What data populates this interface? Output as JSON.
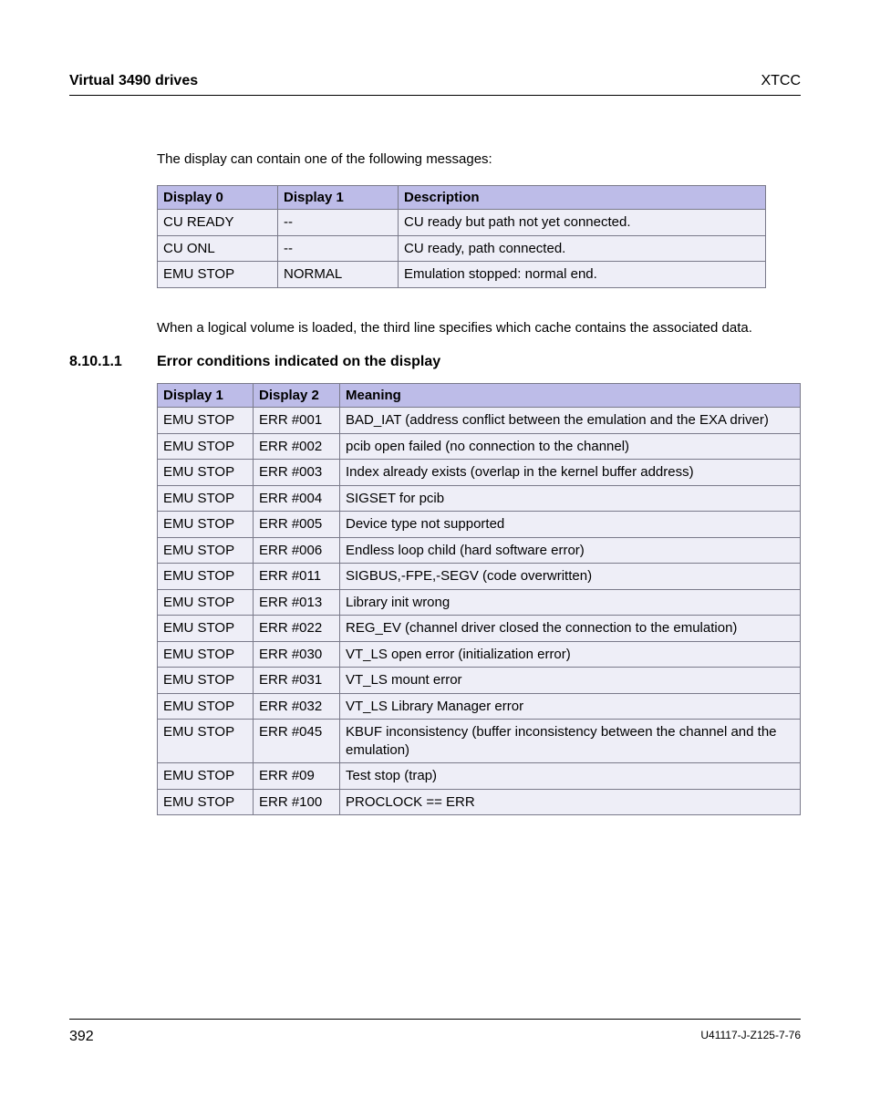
{
  "header": {
    "left": "Virtual 3490 drives",
    "right": "XTCC"
  },
  "intro_para": "The display can contain one of the following messages:",
  "table1": {
    "headers": [
      "Display 0",
      "Display 1",
      "Description"
    ],
    "rows": [
      [
        "CU READY",
        "--",
        "CU ready but path not yet connected."
      ],
      [
        "CU ONL",
        "--",
        "CU ready, path connected."
      ],
      [
        "EMU STOP",
        "NORMAL",
        "Emulation stopped: normal end."
      ]
    ]
  },
  "middle_para": "When a logical volume is loaded, the third line specifies which cache contains the associated data.",
  "section": {
    "number": "8.10.1.1",
    "title": "Error conditions indicated on the display"
  },
  "table2": {
    "headers": [
      "Display 1",
      "Display 2",
      "Meaning"
    ],
    "rows": [
      [
        "EMU STOP",
        "ERR #001",
        "BAD_IAT (address conflict between the emulation and the EXA driver)"
      ],
      [
        "EMU STOP",
        "ERR #002",
        "pcib open failed (no connection to the channel)"
      ],
      [
        "EMU STOP",
        "ERR #003",
        "Index already exists (overlap in the kernel buffer address)"
      ],
      [
        "EMU STOP",
        "ERR #004",
        "SIGSET for pcib"
      ],
      [
        "EMU STOP",
        "ERR #005",
        "Device type not supported"
      ],
      [
        "EMU STOP",
        "ERR #006",
        "Endless loop child (hard software error)"
      ],
      [
        "EMU STOP",
        "ERR #011",
        "SIGBUS,-FPE,-SEGV (code overwritten)"
      ],
      [
        "EMU STOP",
        "ERR #013",
        "Library init wrong"
      ],
      [
        "EMU STOP",
        "ERR #022",
        "REG_EV (channel driver closed the connection to the emulation)"
      ],
      [
        "EMU STOP",
        "ERR #030",
        "VT_LS open error (initialization error)"
      ],
      [
        "EMU STOP",
        "ERR #031",
        "VT_LS mount error"
      ],
      [
        "EMU STOP",
        "ERR #032",
        "VT_LS Library Manager error"
      ],
      [
        "EMU STOP",
        "ERR #045",
        "KBUF inconsistency (buffer inconsistency between the channel and the emulation)"
      ],
      [
        "EMU STOP",
        "ERR #09",
        "Test stop (trap)"
      ],
      [
        "EMU STOP",
        "ERR #100",
        "PROCLOCK == ERR"
      ]
    ]
  },
  "footer": {
    "page": "392",
    "docid": "U41117-J-Z125-7-76"
  }
}
